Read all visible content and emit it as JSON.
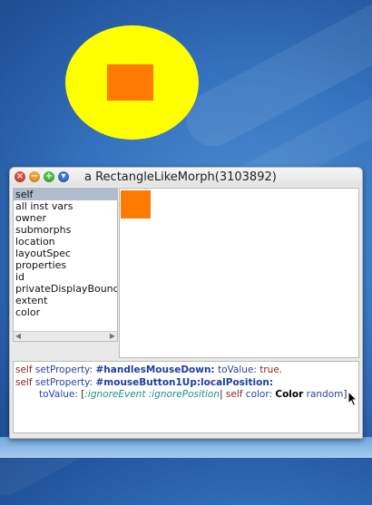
{
  "window": {
    "title": "a RectangleLikeMorph(3103892)",
    "controls": {
      "close": "×",
      "minimize": "−",
      "maximize": "+",
      "menu": "▾"
    }
  },
  "inspector": {
    "fields": [
      "self",
      "all inst vars",
      "owner",
      "submorphs",
      "location",
      "layoutSpec",
      "properties",
      "id",
      "privateDisplayBounds",
      "extent",
      "color"
    ],
    "selected_index": 0
  },
  "code": {
    "line1": {
      "receiver": "self",
      "selector": "setProperty:",
      "symbol": "#handlesMouseDown:",
      "keyword": "toValue:",
      "literal": "true."
    },
    "line2": {
      "receiver": "self",
      "selector": "setProperty:",
      "symbol": "#mouseButton1Up:localPosition:"
    },
    "line3": {
      "keyword": "toValue:",
      "open": "[",
      "args": ":ignoreEvent :ignorePosition",
      "bar": "|",
      "receiver": "self",
      "selector": "color:",
      "class_name": "Color",
      "message": "random",
      "close": "]."
    }
  },
  "colors": {
    "ellipse": "#ffff00",
    "rectangle": "#ff7a00",
    "desktop": "#3674bf"
  },
  "icons": {
    "cursor": "arrow-cursor-icon"
  }
}
